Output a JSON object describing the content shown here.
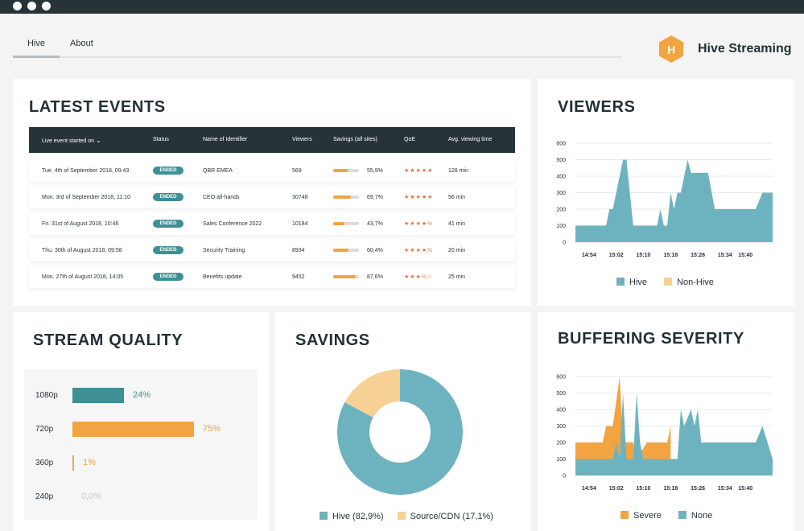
{
  "nav": {
    "tabs": [
      "Hive",
      "About"
    ]
  },
  "brand": {
    "name": "Hive Streaming",
    "logo_letter": "H"
  },
  "latest_events": {
    "title": "LATEST EVENTS",
    "columns": [
      "Live event started on",
      "Status",
      "Name of Identifier",
      "Viewers",
      "Savings (all sites)",
      "QoE",
      "Avg. viewing time"
    ],
    "rows": [
      {
        "date": "Tue. 4th of September 2018, 09:43",
        "status": "ENDED",
        "name": "QBR EMEA",
        "viewers": "569",
        "savings": "55,9%",
        "savings_value": 55.9,
        "qoe": "★★★★★",
        "avg": "128 min"
      },
      {
        "date": "Mon. 3rd of September 2018, 11:10",
        "status": "ENDED",
        "name": "CEO all-hands",
        "viewers": "30748",
        "savings": "69,7%",
        "savings_value": 69.7,
        "qoe": "★★★★★",
        "avg": "56 min"
      },
      {
        "date": "Fri. 31st of August 2018, 10:46",
        "status": "ENDED",
        "name": "Sales Conference 2022",
        "viewers": "10184",
        "savings": "43,7%",
        "savings_value": 43.7,
        "qoe": "★★★★½",
        "avg": "41 min"
      },
      {
        "date": "Thu. 30th of August 2018, 09:58",
        "status": "ENDED",
        "name": "Security Training",
        "viewers": "8934",
        "savings": "60,4%",
        "savings_value": 60.4,
        "qoe": "★★★★½",
        "avg": "20 min"
      },
      {
        "date": "Mon. 27th of August 2018, 14:05",
        "status": "ENDED",
        "name": "Benefits update",
        "viewers": "9452",
        "savings": "87,6%",
        "savings_value": 87.6,
        "qoe": "★★★½☆",
        "avg": "25 min"
      }
    ]
  },
  "viewers": {
    "title": "VIEWERS"
  },
  "stream_quality": {
    "title": "STREAM QUALITY",
    "items": [
      {
        "label": "1080p",
        "value": "24%",
        "percent": 24,
        "color": "#3e8f96"
      },
      {
        "label": "720p",
        "value": "75%",
        "percent": 75,
        "color": "#f2a342"
      },
      {
        "label": "360p",
        "value": "1%",
        "percent": 1,
        "color": "#f2a342"
      },
      {
        "label": "240p",
        "value": "0,0%",
        "percent": 0,
        "color": "#cfcfcf"
      }
    ]
  },
  "savings": {
    "title": "SAVINGS"
  },
  "buffering": {
    "title": "BUFFERING SEVERITY"
  },
  "colors": {
    "teal": "#6db3bf",
    "orange": "#f2a342",
    "beige": "#f7d193",
    "dark": "#26343a"
  },
  "chart_data": [
    {
      "id": "viewers",
      "type": "area",
      "title": "VIEWERS",
      "xlim": [
        "14:50",
        "15:48"
      ],
      "ylim": [
        0,
        600
      ],
      "yticks": [
        0,
        100,
        200,
        300,
        400,
        500,
        600
      ],
      "xticks": [
        "14:54",
        "15:02",
        "15:10",
        "15:18",
        "15:26",
        "15:34",
        "15:40"
      ],
      "grid": true,
      "legend": "bottom",
      "series": [
        {
          "name": "Hive",
          "color": "#6db3bf",
          "points": [
            [
              "14:50",
              100
            ],
            [
              "14:59",
              100
            ],
            [
              "15:00",
              200
            ],
            [
              "15:01",
              200
            ],
            [
              "15:03",
              400
            ],
            [
              "15:04",
              500
            ],
            [
              "15:05",
              500
            ],
            [
              "15:07",
              100
            ],
            [
              "15:14",
              100
            ],
            [
              "15:15",
              200
            ],
            [
              "15:16",
              100
            ],
            [
              "15:17",
              100
            ],
            [
              "15:18",
              300
            ],
            [
              "15:19",
              200
            ],
            [
              "15:20",
              300
            ],
            [
              "15:21",
              300
            ],
            [
              "15:23",
              500
            ],
            [
              "15:24",
              420
            ],
            [
              "15:29",
              420
            ],
            [
              "15:31",
              200
            ],
            [
              "15:43",
              200
            ],
            [
              "15:45",
              300
            ],
            [
              "15:48",
              300
            ]
          ]
        },
        {
          "name": "Non-Hive",
          "color": "#f7d193",
          "points": []
        }
      ]
    },
    {
      "id": "savings",
      "type": "pie",
      "title": "SAVINGS",
      "donut": true,
      "legend": "bottom",
      "slices": [
        {
          "label": "Hive (82,9%)",
          "value": 82.9,
          "color": "#6db3bf"
        },
        {
          "label": "Source/CDN (17,1%)",
          "value": 17.1,
          "color": "#f7d193"
        }
      ]
    },
    {
      "id": "buffering",
      "type": "area",
      "title": "BUFFERING SEVERITY",
      "xlim": [
        "14:50",
        "15:48"
      ],
      "ylim": [
        0,
        600
      ],
      "yticks": [
        0,
        100,
        200,
        300,
        400,
        500,
        600
      ],
      "xticks": [
        "14:54",
        "15:02",
        "15:10",
        "15:18",
        "15:26",
        "15:34",
        "15:40"
      ],
      "grid": true,
      "legend": "bottom",
      "series": [
        {
          "name": "Severe",
          "color": "#f2a342",
          "points": [
            [
              "14:50",
              200
            ],
            [
              "14:58",
              200
            ],
            [
              "14:59",
              300
            ],
            [
              "15:01",
              300
            ],
            [
              "15:03",
              600
            ],
            [
              "15:04",
              200
            ],
            [
              "15:07",
              200
            ],
            [
              "15:08",
              100
            ],
            [
              "15:11",
              200
            ],
            [
              "15:17",
              200
            ],
            [
              "15:18",
              300
            ],
            [
              "15:18",
              0
            ]
          ]
        },
        {
          "name": "None",
          "color": "#6db3bf",
          "points": [
            [
              "14:50",
              100
            ],
            [
              "15:01",
              100
            ],
            [
              "15:02",
              200
            ],
            [
              "15:03",
              100
            ],
            [
              "15:04",
              500
            ],
            [
              "15:05",
              100
            ],
            [
              "15:07",
              100
            ],
            [
              "15:08",
              500
            ],
            [
              "15:09",
              200
            ],
            [
              "15:10",
              100
            ],
            [
              "15:20",
              100
            ],
            [
              "15:21",
              400
            ],
            [
              "15:22",
              300
            ],
            [
              "15:24",
              400
            ],
            [
              "15:25",
              300
            ],
            [
              "15:26",
              400
            ],
            [
              "15:27",
              200
            ],
            [
              "15:43",
              200
            ],
            [
              "15:45",
              300
            ],
            [
              "15:48",
              100
            ]
          ]
        }
      ]
    }
  ]
}
